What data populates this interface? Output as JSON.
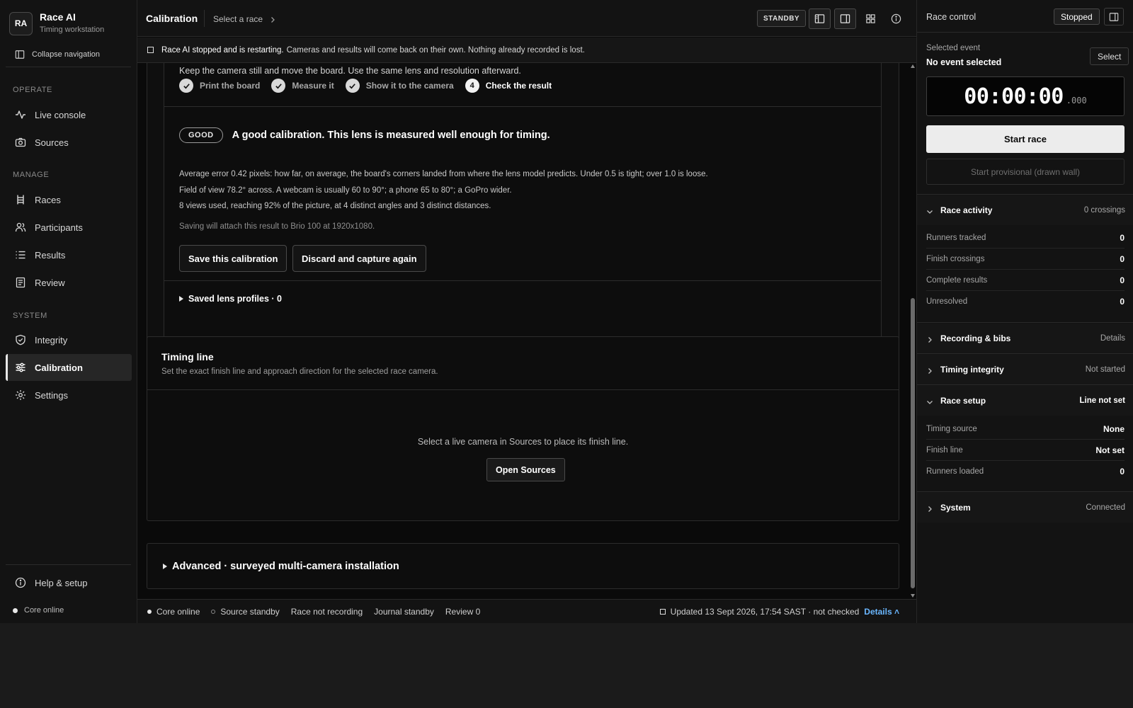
{
  "brand": {
    "initials": "RA",
    "title": "Race AI",
    "subtitle": "Timing workstation"
  },
  "sidebar": {
    "collapse_label": "Collapse navigation",
    "sections": [
      {
        "label": "OPERATE",
        "items": [
          {
            "label": "Live console",
            "icon": "activity-icon"
          },
          {
            "label": "Sources",
            "icon": "camera-icon"
          }
        ]
      },
      {
        "label": "MANAGE",
        "items": [
          {
            "label": "Races",
            "icon": "ladder-icon"
          },
          {
            "label": "Participants",
            "icon": "users-icon"
          },
          {
            "label": "Results",
            "icon": "list-icon"
          },
          {
            "label": "Review",
            "icon": "document-icon"
          }
        ]
      },
      {
        "label": "SYSTEM",
        "items": [
          {
            "label": "Integrity",
            "icon": "shield-icon"
          },
          {
            "label": "Calibration",
            "icon": "sliders-icon",
            "active": true
          },
          {
            "label": "Settings",
            "icon": "gear-icon"
          }
        ]
      }
    ],
    "help_label": "Help & setup",
    "core_status": "Core online"
  },
  "topbar": {
    "title": "Calibration",
    "crumb": "Select a race",
    "standby": "STANDBY"
  },
  "banner": {
    "bold": "Race AI stopped and is restarting.",
    "text": "Cameras and results will come back on their own. Nothing already recorded is lost."
  },
  "calibration": {
    "instruction": "Keep the camera still and move the board. Use the same lens and resolution afterward.",
    "steps": [
      {
        "label": "Print the board",
        "done": true
      },
      {
        "label": "Measure it",
        "done": true
      },
      {
        "label": "Show it to the camera",
        "done": true
      },
      {
        "label": "Check the result",
        "number": "4",
        "current": true
      }
    ],
    "badge": "GOOD",
    "result_title": "A good calibration. This lens is measured well enough for timing.",
    "metrics": [
      "Average error 0.42 pixels: how far, on average, the board's corners landed from where the lens model predicts. Under 0.5 is tight; over 1.0 is loose.",
      "Field of view 78.2° across. A webcam is usually 60 to 90°; a phone 65 to 80°; a GoPro wider.",
      "8 views used, reaching 92% of the picture, at 4 distinct angles and 3 distinct distances."
    ],
    "saving_note": "Saving will attach this result to Brio 100 at 1920x1080.",
    "save_button": "Save this calibration",
    "discard_button": "Discard and capture again",
    "saved_profiles": "Saved lens profiles · 0"
  },
  "timing_line": {
    "title": "Timing line",
    "subtitle": "Set the exact finish line and approach direction for the selected race camera.",
    "empty_text": "Select a live camera in Sources to place its finish line.",
    "button": "Open Sources"
  },
  "advanced": {
    "label": "Advanced · surveyed multi-camera installation"
  },
  "statusbar": {
    "core": "Core online",
    "source": "Source standby",
    "recording": "Race not recording",
    "journal": "Journal standby",
    "review": "Review 0",
    "updated": "Updated 13 Sept 2026, 17:54 SAST · not checked",
    "details": "Details ˄"
  },
  "rightpanel": {
    "title": "Race control",
    "status": "Stopped",
    "selected_label": "Selected event",
    "selected_value": "No event selected",
    "select_button": "Select",
    "clock_main": "00:00:00",
    "clock_ms": ".000",
    "start_button": "Start race",
    "provisional_button": "Start provisional (drawn wall)",
    "race_activity": {
      "label": "Race activity",
      "meta": "0 crossings",
      "rows": [
        {
          "k": "Runners tracked",
          "v": "0"
        },
        {
          "k": "Finish crossings",
          "v": "0"
        },
        {
          "k": "Complete results",
          "v": "0"
        },
        {
          "k": "Unresolved",
          "v": "0"
        }
      ]
    },
    "recording": {
      "label": "Recording & bibs",
      "meta": "Details"
    },
    "integrity": {
      "label": "Timing integrity",
      "meta": "Not started"
    },
    "race_setup": {
      "label": "Race setup",
      "meta": "Line not set",
      "rows": [
        {
          "k": "Timing source",
          "v": "None"
        },
        {
          "k": "Finish line",
          "v": "Not set"
        },
        {
          "k": "Runners loaded",
          "v": "0"
        }
      ]
    },
    "system": {
      "label": "System",
      "meta": "Connected"
    }
  },
  "colors": {
    "background": "#0a0a0a",
    "panel": "#131313",
    "accent_link": "#6ab7ff",
    "primary_button": "#ececec"
  }
}
